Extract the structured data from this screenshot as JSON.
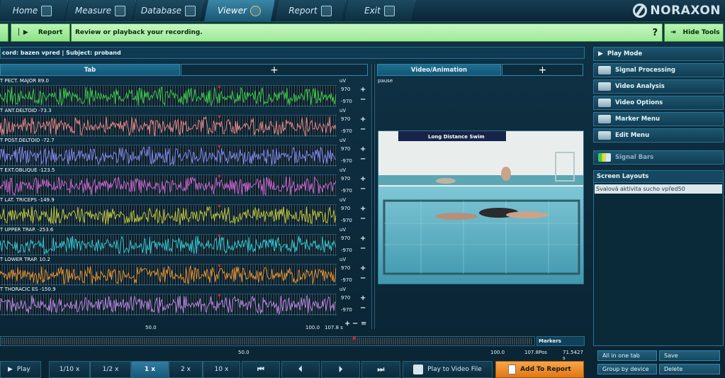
{
  "nav": {
    "tabs": [
      {
        "label": "Home",
        "icon": "home-icon"
      },
      {
        "label": "Measure",
        "icon": "measure-icon"
      },
      {
        "label": "Database",
        "icon": "database-icon"
      },
      {
        "label": "Viewer",
        "icon": "viewer-icon",
        "active": true
      },
      {
        "label": "Report",
        "icon": "report-icon"
      },
      {
        "label": "Exit",
        "icon": "exit-icon"
      }
    ],
    "brand": "NORAXON"
  },
  "toolbar": {
    "report_label": "Report",
    "message": "Review or playback your recording.",
    "help": "?",
    "hide_tools_label": "Hide Tools"
  },
  "record": {
    "title": "cord: bazen vpred | Subject: proband"
  },
  "signal_pane": {
    "tab_label": "Tab",
    "add_label": "+",
    "units": "uV",
    "channels": [
      {
        "label": "T PECT. MAJOR  89.0",
        "max": "970",
        "min": "-970",
        "color": "#3fcf4a"
      },
      {
        "label": "T ANT.DELTOID  -73.3",
        "max": "970",
        "min": "-970",
        "color": "#f08a8a"
      },
      {
        "label": "T POST.DELTOID  -72.7",
        "max": "970",
        "min": "-970",
        "color": "#8a8af5"
      },
      {
        "label": "T EXT.OBLIQUE  -123.5",
        "max": "970",
        "min": "-970",
        "color": "#d466d4"
      },
      {
        "label": "T LAT. TRICEPS  -149.9",
        "max": "970",
        "min": "-970",
        "color": "#cbcf3a"
      },
      {
        "label": "T UPPER TRAP.  -253.6",
        "max": "970",
        "min": "-970",
        "color": "#33d0d8"
      },
      {
        "label": "T LOWER TRAP.  10.2",
        "max": "970",
        "min": "-970",
        "color": "#f0962e"
      },
      {
        "label": "T THORACIC ES  -150.9",
        "max": "970",
        "min": "-970",
        "color": "#c389e8"
      }
    ],
    "axis": {
      "t50": "50.0",
      "t100": "100.0",
      "end": "107.8 s"
    }
  },
  "video_pane": {
    "tab_label": "Video/Animation",
    "add_label": "+",
    "state": "pause",
    "banner": "Long Distance Swim"
  },
  "tools": {
    "items": [
      {
        "label": "Play Mode",
        "icon": "play-icon"
      },
      {
        "label": "Signal Processing",
        "icon": "signal-processing-icon"
      },
      {
        "label": "Video Analysis",
        "icon": "video-camera-icon"
      },
      {
        "label": "Video Options",
        "icon": "video-options-icon"
      },
      {
        "label": "Marker Menu",
        "icon": "marker-icon"
      },
      {
        "label": "Edit Menu",
        "icon": "edit-icon"
      }
    ],
    "signal_bars": "Signal Bars",
    "layouts_header": "Screen Layouts",
    "layouts": [
      "Svalová aktivita sucho vpřed50"
    ],
    "all_in_one_tab": "All in one tab",
    "save": "Save",
    "group_by_device": "Group by device",
    "delete": "Delete"
  },
  "timeline": {
    "markers_label": "Markers",
    "t50": "50.0",
    "t100": "100.0",
    "end": "107.8",
    "pos_label": "Pos",
    "pos_value": "71.5427 s"
  },
  "controls": {
    "play": "Play",
    "speeds": [
      "1/10 x",
      "1/2 x",
      "1 x",
      "2 x",
      "10 x"
    ],
    "active_speed": "1 x",
    "play_to_video": "Play to Video File",
    "add_to_report": "Add To Report"
  }
}
